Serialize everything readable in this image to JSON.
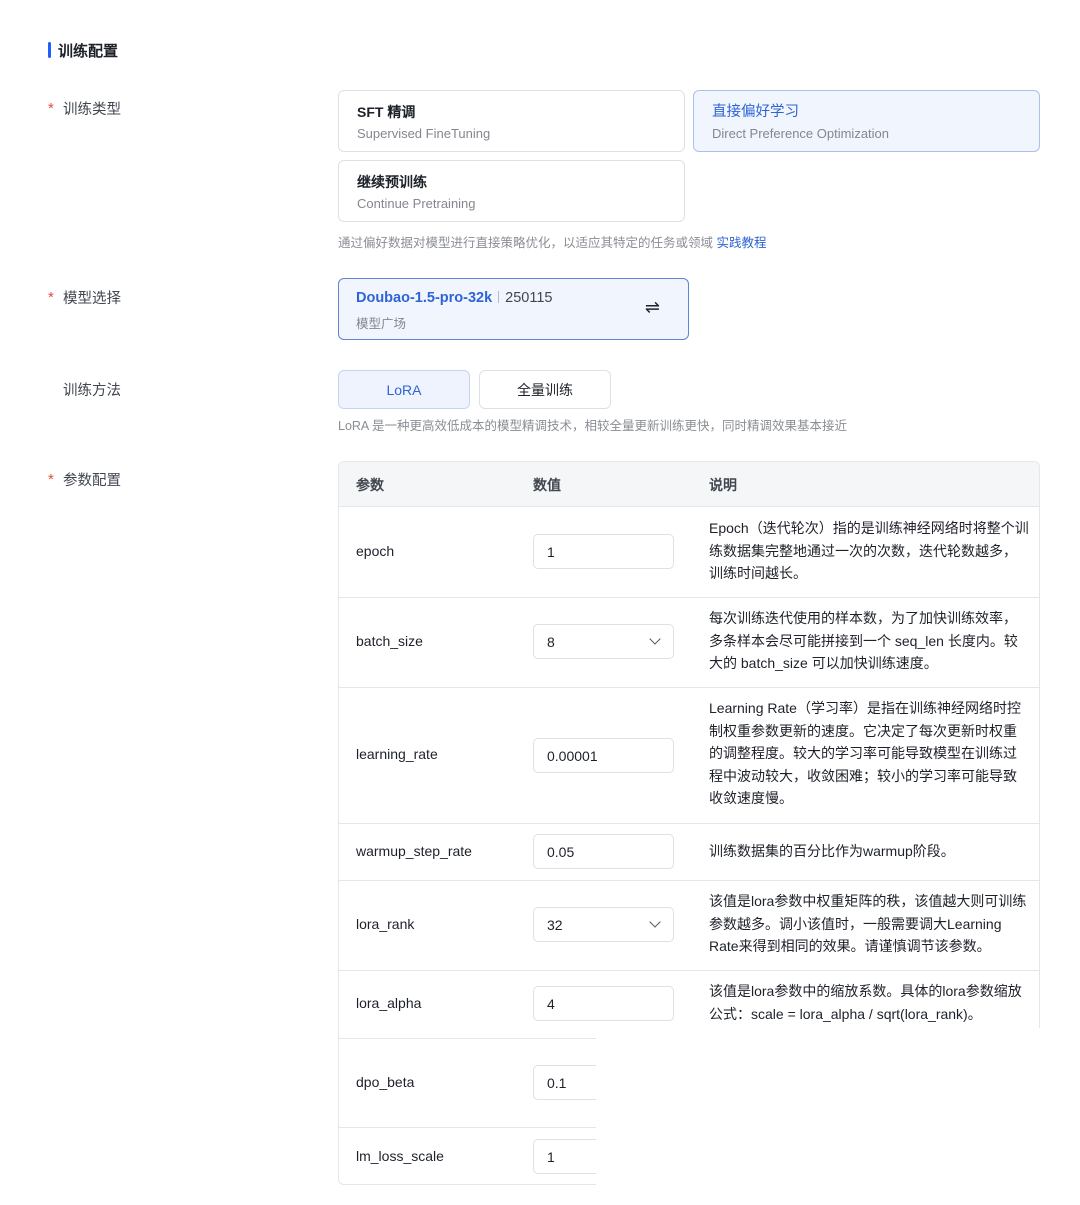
{
  "section": {
    "title": "训练配置"
  },
  "training_type": {
    "label": "训练类型",
    "options": [
      {
        "title": "SFT 精调",
        "subtitle": "Supervised FineTuning"
      },
      {
        "title": "直接偏好学习",
        "subtitle": "Direct Preference Optimization",
        "selected": true
      },
      {
        "title": "继续预训练",
        "subtitle": "Continue Pretraining"
      }
    ],
    "hint": "通过偏好数据对模型进行直接策略优化，以适应其特定的任务或领域",
    "hint_link": "实践教程"
  },
  "model": {
    "label": "模型选择",
    "name": "Doubao-1.5-pro-32k",
    "version": "250115",
    "source": "模型广场",
    "swap_icon": "⇌"
  },
  "method": {
    "label": "训练方法",
    "options": [
      "LoRA",
      "全量训练"
    ],
    "selected": "LoRA",
    "hint": "LoRA 是一种更高效低成本的模型精调技术，相较全量更新训练更快，同时精调效果基本接近"
  },
  "params": {
    "label": "参数配置",
    "headers": {
      "param": "参数",
      "value": "数值",
      "desc": "说明"
    },
    "rows": [
      {
        "name": "epoch",
        "value": "1",
        "type": "input",
        "desc": "Epoch（迭代轮次）指的是训练神经网络时将整个训练数据集完整地通过一次的次数，迭代轮数越多，训练时间越长。"
      },
      {
        "name": "batch_size",
        "value": "8",
        "type": "select",
        "desc": "每次训练迭代使用的样本数，为了加快训练效率，多条样本会尽可能拼接到一个 seq_len 长度内。较大的 batch_size 可以加快训练速度。"
      },
      {
        "name": "learning_rate",
        "value": "0.00001",
        "type": "input",
        "desc": "Learning Rate（学习率）是指在训练神经网络时控制权重参数更新的速度。它决定了每次更新时权重的调整程度。较大的学习率可能导致模型在训练过程中波动较大，收敛困难；较小的学习率可能导致收敛速度慢。"
      },
      {
        "name": "warmup_step_rate",
        "value": "0.05",
        "type": "input",
        "desc": "训练数据集的百分比作为warmup阶段。"
      },
      {
        "name": "lora_rank",
        "value": "32",
        "type": "select",
        "desc": "该值是lora参数中权重矩阵的秩，该值越大则可训练参数越多。调小该值时，一般需要调大Learning Rate来得到相同的效果。请谨慎调节该参数。"
      },
      {
        "name": "lora_alpha",
        "value": "4",
        "type": "input",
        "desc": "该值是lora参数中的缩放系数。具体的lora参数缩放公式：scale = lora_alpha / sqrt(lora_rank)。"
      },
      {
        "name": "dpo_beta",
        "value": "0.1",
        "type": "input",
        "desc": ""
      },
      {
        "name": "lm_loss_scale",
        "value": "1",
        "type": "input",
        "desc": ""
      }
    ]
  }
}
